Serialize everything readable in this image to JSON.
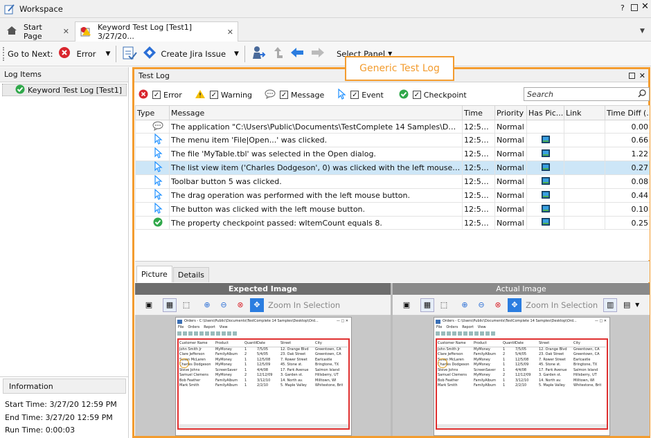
{
  "window": {
    "title": "Workspace",
    "help": "?"
  },
  "tabs": [
    {
      "label": "Start Page"
    },
    {
      "label": "Keyword Test Log [Test1] 3/27/20..."
    }
  ],
  "toolbar": {
    "goto_label": "Go to Next:",
    "error_label": "Error",
    "jira_label": "Create Jira Issue",
    "select_panel_label": "Select Panel"
  },
  "left_panel": {
    "header": "Log Items",
    "tree_item": "Keyword Test Log [Test1]",
    "info_header": "Information",
    "start_time": "Start Time: 3/27/20 12:59 PM",
    "end_time": "End Time: 3/27/20 12:59 PM",
    "run_time": "Run Time: 0:00:03"
  },
  "callout": "Generic Test Log",
  "test_log": {
    "header": "Test Log",
    "filters": {
      "error": "Error",
      "warning": "Warning",
      "message": "Message",
      "event": "Event",
      "checkpoint": "Checkpoint"
    },
    "search_placeholder": "Search",
    "columns": [
      "Type",
      "Message",
      "Time",
      "Priority",
      "Has Pic...",
      "Link",
      "Time Diff (..."
    ],
    "rows": [
      {
        "type": "message",
        "message": "The application \"C:\\Users\\Public\\Documents\\TestComplete 14 Samples\\Desktop\\Ord...",
        "time": "12:59...",
        "priority": "Normal",
        "pic": false,
        "diff": "0.00"
      },
      {
        "type": "event",
        "message": "The menu item 'File|Open...' was clicked.",
        "time": "12:59...",
        "priority": "Normal",
        "pic": true,
        "diff": "0.66"
      },
      {
        "type": "event",
        "message": "The file 'MyTable.tbl' was selected in the Open dialog.",
        "time": "12:59...",
        "priority": "Normal",
        "pic": true,
        "diff": "1.22"
      },
      {
        "type": "event",
        "message": "The list view item ('Charles Dodgeson', 0) was clicked with the left mouse button.",
        "time": "12:59...",
        "priority": "Normal",
        "pic": true,
        "diff": "0.27"
      },
      {
        "type": "event",
        "message": "Toolbar button 5 was clicked.",
        "time": "12:59...",
        "priority": "Normal",
        "pic": true,
        "diff": "0.08"
      },
      {
        "type": "event",
        "message": "The drag operation was performed with the left mouse button.",
        "time": "12:59...",
        "priority": "Normal",
        "pic": true,
        "diff": "0.44"
      },
      {
        "type": "event",
        "message": "The button was clicked with the left mouse button.",
        "time": "12:59...",
        "priority": "Normal",
        "pic": true,
        "diff": "0.10"
      },
      {
        "type": "checkpoint",
        "message": "The property checkpoint passed: wItemCount equals 8.",
        "time": "12:59...",
        "priority": "Normal",
        "pic": true,
        "diff": "0.25"
      }
    ]
  },
  "bottom_tabs": [
    "Picture",
    "Details"
  ],
  "images": {
    "expected_title": "Expected Image",
    "actual_title": "Actual Image",
    "zoom_label": "Zoom In Selection"
  },
  "app_shot": {
    "title": "Orders - C:\\Users\\Public\\Documents\\TestComplete 14 Samples\\Desktop\\Ord...",
    "menu": [
      "File",
      "Orders",
      "Report",
      "View"
    ],
    "headers": [
      "Customer Name",
      "Product",
      "Quantity",
      "Date",
      "Street",
      "City"
    ],
    "rows": [
      [
        "John Smith Jr",
        "MyMoney",
        "1",
        "7/5/05",
        "12. Orange Blvd",
        "Greentown, CA"
      ],
      [
        "Clare Jefferson",
        "FamilyAlbum",
        "2",
        "5/4/05",
        "23. Oak Street",
        "Greentown, CA"
      ],
      [
        "Susan McLaren",
        "MyMoney",
        "1",
        "12/5/08",
        "7. Rower Street",
        "Earlcastle"
      ],
      [
        "Charles Dodgeson",
        "MyMoney",
        "1",
        "12/5/09",
        "45. Stone st.",
        "Bringtone, TX"
      ],
      [
        "Steve Johns",
        "ScreenSaver",
        "1",
        "4/4/08",
        "17. Park Avenue",
        "Salmon Island"
      ],
      [
        "Samuel Clemens",
        "MyMoney",
        "2",
        "12/12/09",
        "3. Garden st.",
        "Hillsberry, UT"
      ],
      [
        "Bob Feather",
        "FamilyAlbum",
        "1",
        "3/12/10",
        "14. North av.",
        "Milltown, WI"
      ],
      [
        "Mark Smith",
        "FamilyAlbum",
        "1",
        "2/2/10",
        "5. Maple Valley",
        "Whitestone, British"
      ]
    ]
  },
  "colors": {
    "orange_highlight": "#f39c2f",
    "selected_row": "#cde6f7",
    "error_red": "#d9262e",
    "checkpoint_green": "#2fa84a",
    "event_blue": "#1e90ff"
  }
}
